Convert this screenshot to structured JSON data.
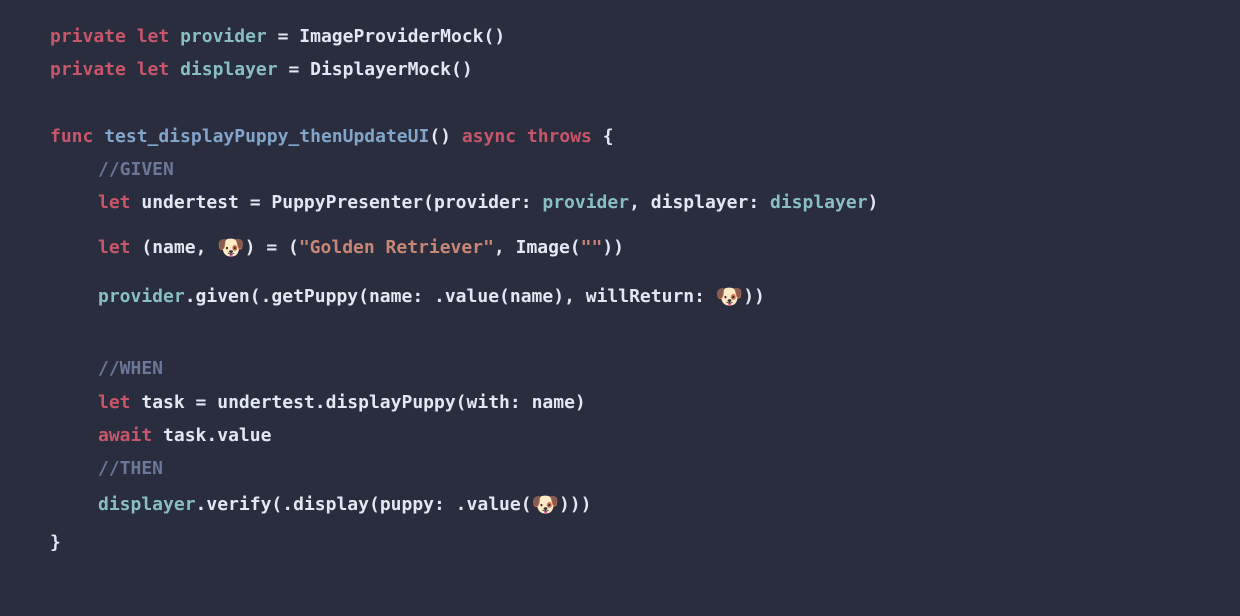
{
  "line1": {
    "kw_private": "private",
    "kw_let": "let",
    "ident": "provider",
    "eq": " = ",
    "type": "ImageProviderMock",
    "paren": "()"
  },
  "line2": {
    "kw_private": "private",
    "kw_let": "let",
    "ident": "displayer",
    "eq": " = ",
    "type": "DisplayerMock",
    "paren": "()"
  },
  "line3": {
    "kw_func": "func",
    "fn": "test_displayPuppy_thenUpdateUI",
    "paren": "()",
    "kw_async": "async",
    "kw_throws": "throws",
    "brace": " {"
  },
  "line4": {
    "comment": "//GIVEN"
  },
  "line5": {
    "kw_let": "let",
    "ident": "undertest",
    "eq": " = ",
    "type": "PuppyPresenter",
    "open": "(",
    "p1lbl": "provider",
    "colon1": ": ",
    "p1val": "provider",
    "comma1": ", ",
    "p2lbl": "displayer",
    "colon2": ": ",
    "p2val": "displayer",
    "close": ")"
  },
  "line6": {
    "kw_let": "let",
    "open": " (",
    "v1": "name",
    "comma1": ", ",
    "emoji": "🐶",
    "close1": ") = (",
    "str": "\"Golden Retriever\"",
    "comma2": ", ",
    "type": "Image",
    "open2": "(",
    "str2": "\"\"",
    "close2": "))"
  },
  "line7": {
    "ident": "provider",
    "dot": ".",
    "method": "given",
    "open": "(.",
    "call": "getPuppy",
    "open2": "(",
    "p1lbl": "name",
    "colon1": ": .",
    "valmethod": "value",
    "open3": "(",
    "arg": "name",
    "close3": "), ",
    "p2lbl": "willReturn",
    "colon2": ": ",
    "emoji": "🐶",
    "close": "))"
  },
  "line8": {
    "comment": "//WHEN"
  },
  "line9": {
    "kw_let": "let",
    "ident": "task",
    "eq": " = ",
    "obj": "undertest",
    "dot": ".",
    "method": "displayPuppy",
    "open": "(",
    "plbl": "with",
    "colon": ": ",
    "arg": "name",
    "close": ")"
  },
  "line10": {
    "kw_await": "await",
    "sp": " ",
    "obj": "task",
    "dot": ".",
    "prop": "value"
  },
  "line11": {
    "comment": "//THEN"
  },
  "line12": {
    "ident": "displayer",
    "dot": ".",
    "method": "verify",
    "open": "(.",
    "call": "display",
    "open2": "(",
    "plbl": "puppy",
    "colon": ": .",
    "valmethod": "value",
    "open3": "(",
    "emoji": "🐶",
    "close": ")))"
  },
  "line13": {
    "brace": "}"
  }
}
